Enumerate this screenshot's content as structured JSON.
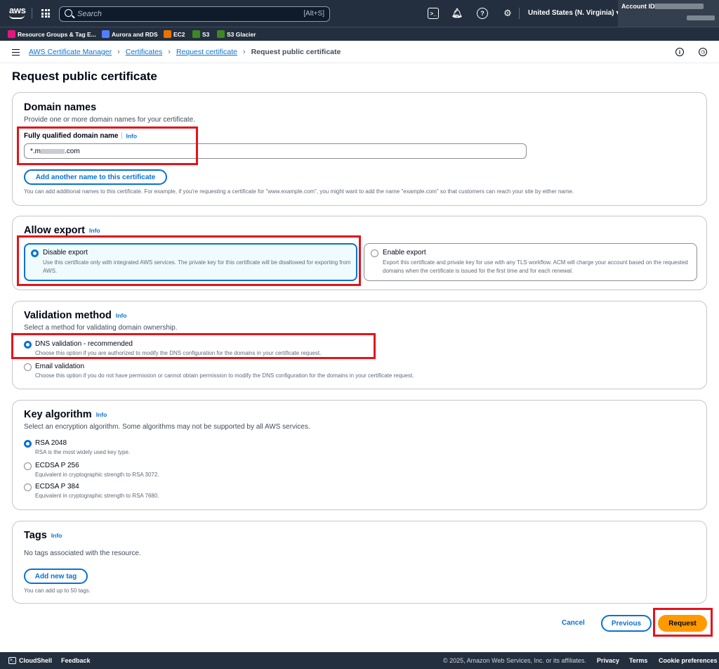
{
  "topnav": {
    "logo_text": "aws",
    "search_placeholder": "Search",
    "search_shortcut": "[Alt+S]",
    "region": "United States (N. Virginia) ▾",
    "account_label": "Account ID:"
  },
  "favorites": [
    {
      "label": "Resource Groups & Tag E...",
      "color": "#e7157b"
    },
    {
      "label": "Aurora and RDS",
      "color": "#527fff"
    },
    {
      "label": "EC2",
      "color": "#ed7100"
    },
    {
      "label": "S3",
      "color": "#3f8624"
    },
    {
      "label": "S3 Glacier",
      "color": "#3f8624"
    }
  ],
  "breadcrumb": {
    "items": [
      "AWS Certificate Manager",
      "Certificates",
      "Request certificate"
    ],
    "current": "Request public certificate"
  },
  "page_title": "Request public certificate",
  "domain_names": {
    "title": "Domain names",
    "description": "Provide one or more domain names for your certificate.",
    "field_label": "Fully qualified domain name",
    "info": "Info",
    "value_prefix": "*.m",
    "value_suffix": ".com",
    "add_button": "Add another name to this certificate",
    "hint": "You can add additional names to this certificate. For example, if you're requesting a certificate for \"www.example.com\", you might want to add the name \"example.com\" so that customers can reach your site by either name."
  },
  "allow_export": {
    "title": "Allow export",
    "info": "Info",
    "options": [
      {
        "title": "Disable export",
        "desc": "Use this certificate only with integrated AWS services. The private key for this certificate will be disallowed for exporting from AWS.",
        "selected": true
      },
      {
        "title": "Enable export",
        "desc": "Export this certificate and private key for use with any TLS workflow. ACM will charge your account based on the requested domains when the certificate is issued for the first time and for each renewal.",
        "selected": false
      }
    ]
  },
  "validation": {
    "title": "Validation method",
    "info": "Info",
    "description": "Select a method for validating domain ownership.",
    "options": [
      {
        "title": "DNS validation - recommended",
        "desc": "Choose this option if you are authorized to modify the DNS configuration for the domains in your certificate request.",
        "selected": true
      },
      {
        "title": "Email validation",
        "desc": "Choose this option if you do not have permission or cannot obtain permission to modify the DNS configuration for the domains in your certificate request.",
        "selected": false
      }
    ]
  },
  "key_algorithm": {
    "title": "Key algorithm",
    "info": "Info",
    "description": "Select an encryption algorithm. Some algorithms may not be supported by all AWS services.",
    "options": [
      {
        "title": "RSA 2048",
        "desc": "RSA is the most widely used key type.",
        "selected": true
      },
      {
        "title": "ECDSA P 256",
        "desc": "Equivalent in cryptographic strength to RSA 3072.",
        "selected": false
      },
      {
        "title": "ECDSA P 384",
        "desc": "Equivalent in cryptographic strength to RSA 7680.",
        "selected": false
      }
    ]
  },
  "tags": {
    "title": "Tags",
    "info": "Info",
    "description": "No tags associated with the resource.",
    "add_button": "Add new tag",
    "hint": "You can add up to 50 tags."
  },
  "actions": {
    "cancel": "Cancel",
    "previous": "Previous",
    "request": "Request"
  },
  "footer": {
    "cloudshell": "CloudShell",
    "feedback": "Feedback",
    "copyright": "© 2025, Amazon Web Services, Inc. or its affiliates.",
    "privacy": "Privacy",
    "terms": "Terms",
    "cookies": "Cookie preferences"
  },
  "colors": {
    "nav_bg": "#232f3e",
    "link": "#0972d3",
    "primary": "#ff9900",
    "highlight": "#e3141b"
  }
}
